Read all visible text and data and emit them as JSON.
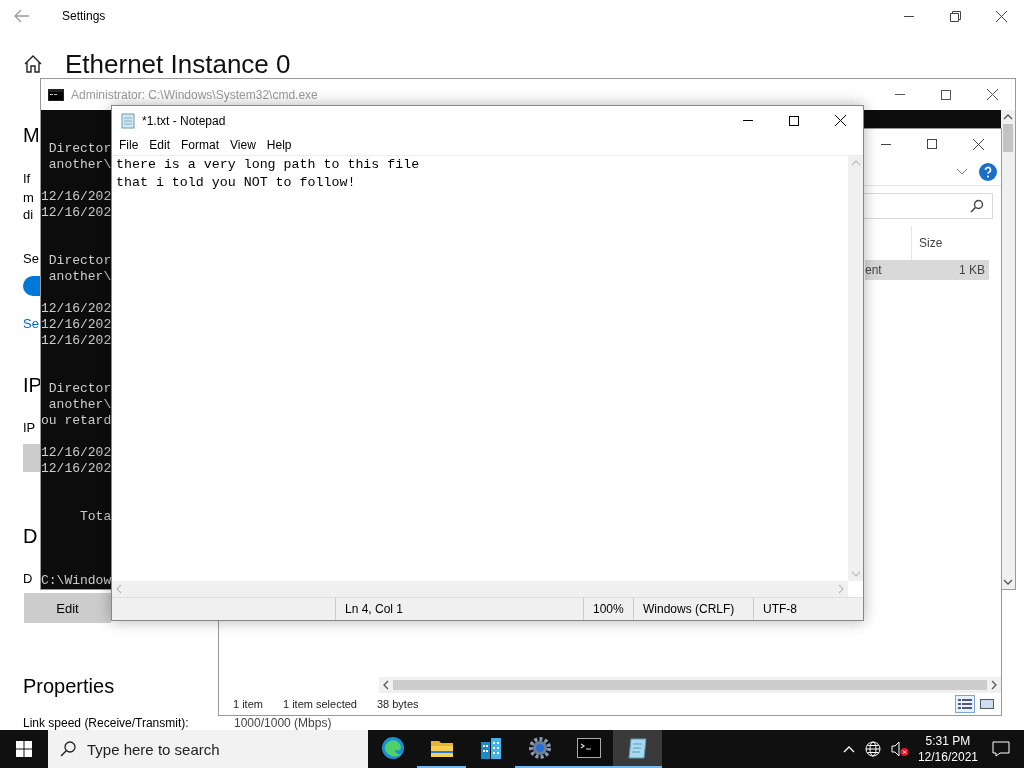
{
  "settings": {
    "title": "Settings",
    "heading": "Ethernet Instance 0",
    "items": [
      {
        "kind": "heading",
        "text": "M"
      },
      {
        "kind": "text",
        "text": "If"
      },
      {
        "kind": "text",
        "text": "m"
      },
      {
        "kind": "text",
        "text": "di"
      },
      {
        "kind": "text",
        "text": "Se"
      },
      {
        "kind": "toggle",
        "on": true
      },
      {
        "kind": "link",
        "text": "Se"
      },
      {
        "kind": "heading",
        "text": "IP"
      },
      {
        "kind": "text",
        "text": "IP"
      },
      {
        "kind": "field"
      },
      {
        "kind": "heading",
        "text": "D"
      },
      {
        "kind": "text",
        "text": "D"
      },
      {
        "kind": "button",
        "text": "Edit"
      },
      {
        "kind": "heading",
        "text": "Properties"
      },
      {
        "kind": "property",
        "label": "Link speed (Receive/Transmit):",
        "value": "1000/1000 (Mbps)"
      }
    ]
  },
  "command_prompt": {
    "title": "Administrator: C:\\Windows\\System32\\cmd.exe",
    "lines": [
      {
        "kind": "line",
        "text": " Director"
      },
      {
        "kind": "line",
        "text": " another\\"
      },
      {
        "kind": "blank"
      },
      {
        "kind": "line",
        "text": "12/16/202"
      },
      {
        "kind": "line",
        "text": "12/16/202"
      },
      {
        "kind": "blank"
      },
      {
        "kind": "blank"
      },
      {
        "kind": "line",
        "text": " Director"
      },
      {
        "kind": "line",
        "text": " another\\"
      },
      {
        "kind": "blank"
      },
      {
        "kind": "line",
        "text": "12/16/202"
      },
      {
        "kind": "line",
        "text": "12/16/202"
      },
      {
        "kind": "line",
        "text": "12/16/202"
      },
      {
        "kind": "blank"
      },
      {
        "kind": "blank"
      },
      {
        "kind": "line",
        "text": " Director"
      },
      {
        "kind": "line",
        "text": " another\\"
      },
      {
        "kind": "line",
        "text": "ou retard"
      },
      {
        "kind": "blank"
      },
      {
        "kind": "line",
        "text": "12/16/202"
      },
      {
        "kind": "line",
        "text": "12/16/202"
      },
      {
        "kind": "blank"
      },
      {
        "kind": "blank"
      },
      {
        "kind": "line",
        "text": "     Tota"
      },
      {
        "kind": "blank"
      },
      {
        "kind": "blank"
      },
      {
        "kind": "blank"
      },
      {
        "kind": "line",
        "text": "C:\\Window"
      }
    ]
  },
  "file_explorer": {
    "columns": [
      "Size"
    ],
    "rows": [
      {
        "column_1": "ent",
        "size": "1 KB",
        "selected": true
      }
    ],
    "status": [
      "1 item",
      "1 item selected",
      "38 bytes"
    ],
    "views": [
      {
        "kind": "details",
        "selected": true
      },
      {
        "kind": "tiles",
        "selected": false
      }
    ]
  },
  "notepad": {
    "title": "*1.txt - Notepad",
    "menu": [
      "File",
      "Edit",
      "Format",
      "View",
      "Help"
    ],
    "text": "there is a very long path to this file\nthat i told you NOT to follow!",
    "status": [
      "Ln 4, Col 1",
      "100%",
      "Windows (CRLF)",
      "UTF-8"
    ]
  },
  "taskbar": {
    "search": {
      "placeholder": "Type here to search"
    },
    "apps": [
      {
        "kind": "edge",
        "running": false,
        "selected": false
      },
      {
        "kind": "folder",
        "running": true,
        "selected": false
      },
      {
        "kind": "buildings",
        "running": false,
        "selected": false
      },
      {
        "kind": "gear",
        "running": true,
        "selected": false
      },
      {
        "kind": "terminal",
        "running": true,
        "selected": false
      },
      {
        "kind": "notepad",
        "running": true,
        "selected": true
      }
    ],
    "time": "5:31 PM",
    "date": "12/16/2021"
  }
}
